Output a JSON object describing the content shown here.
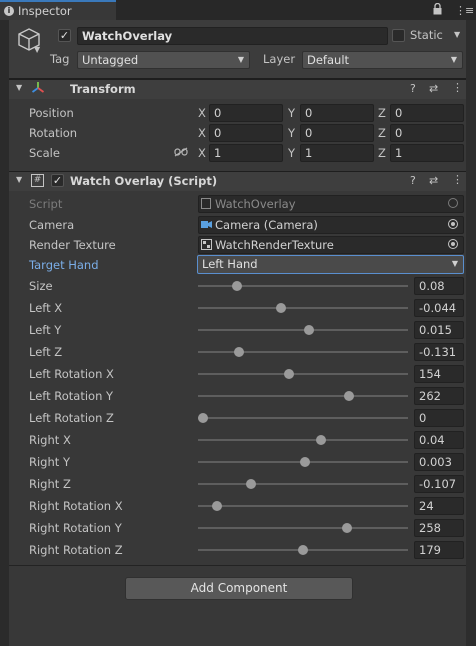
{
  "tab": {
    "title": "Inspector"
  },
  "gameobject": {
    "name": "WatchOverlay",
    "static_label": "Static",
    "tag_label": "Tag",
    "tag_value": "Untagged",
    "layer_label": "Layer",
    "layer_value": "Default"
  },
  "transform": {
    "title": "Transform",
    "rows": [
      {
        "label": "Position",
        "x": "0",
        "y": "0",
        "z": "0"
      },
      {
        "label": "Rotation",
        "x": "0",
        "y": "0",
        "z": "0"
      },
      {
        "label": "Scale",
        "x": "1",
        "y": "1",
        "z": "1"
      }
    ],
    "axes": {
      "x": "X",
      "y": "Y",
      "z": "Z"
    }
  },
  "script": {
    "title": "Watch Overlay (Script)",
    "script_label": "Script",
    "script_value": "WatchOverlay",
    "camera_label": "Camera",
    "camera_value": "Camera (Camera)",
    "rt_label": "Render Texture",
    "rt_value": "WatchRenderTexture",
    "hand_label": "Target Hand",
    "hand_value": "Left Hand",
    "sliders": [
      {
        "label": "Size",
        "value": "0.08",
        "pos": 0.17
      },
      {
        "label": "Left X",
        "value": "-0.044",
        "pos": 0.39
      },
      {
        "label": "Left Y",
        "value": "0.015",
        "pos": 0.53
      },
      {
        "label": "Left Z",
        "value": "-0.131",
        "pos": 0.18
      },
      {
        "label": "Left Rotation X",
        "value": "154",
        "pos": 0.43
      },
      {
        "label": "Left Rotation Y",
        "value": "262",
        "pos": 0.73
      },
      {
        "label": "Left Rotation Z",
        "value": "0",
        "pos": 0.0
      },
      {
        "label": "Right X",
        "value": "0.04",
        "pos": 0.59
      },
      {
        "label": "Right Y",
        "value": "0.003",
        "pos": 0.51
      },
      {
        "label": "Right Z",
        "value": "-0.107",
        "pos": 0.24
      },
      {
        "label": "Right Rotation X",
        "value": "24",
        "pos": 0.07
      },
      {
        "label": "Right Rotation Y",
        "value": "258",
        "pos": 0.72
      },
      {
        "label": "Right Rotation Z",
        "value": "179",
        "pos": 0.5
      }
    ]
  },
  "add_component": "Add Component",
  "colors": {
    "accent": "#3a79bb",
    "highlight_label": "#7baee8",
    "background": "#383838"
  }
}
